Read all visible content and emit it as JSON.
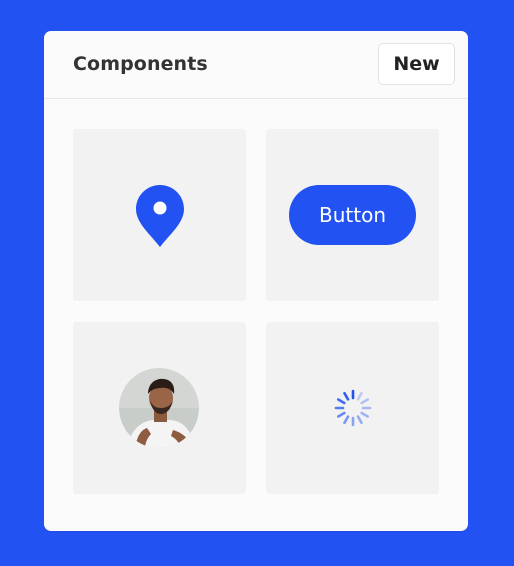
{
  "panel": {
    "title": "Components",
    "new_button_label": "New"
  },
  "tiles": [
    {
      "kind": "location-pin",
      "icon": "map-pin-icon"
    },
    {
      "kind": "button",
      "label": "Button"
    },
    {
      "kind": "avatar",
      "icon": "user-photo"
    },
    {
      "kind": "spinner",
      "icon": "loading-spinner-icon"
    }
  ],
  "colors": {
    "background": "#2352F2",
    "accent": "#2352F2",
    "panel": "#FBFBFB",
    "tile": "#F2F2F2"
  }
}
